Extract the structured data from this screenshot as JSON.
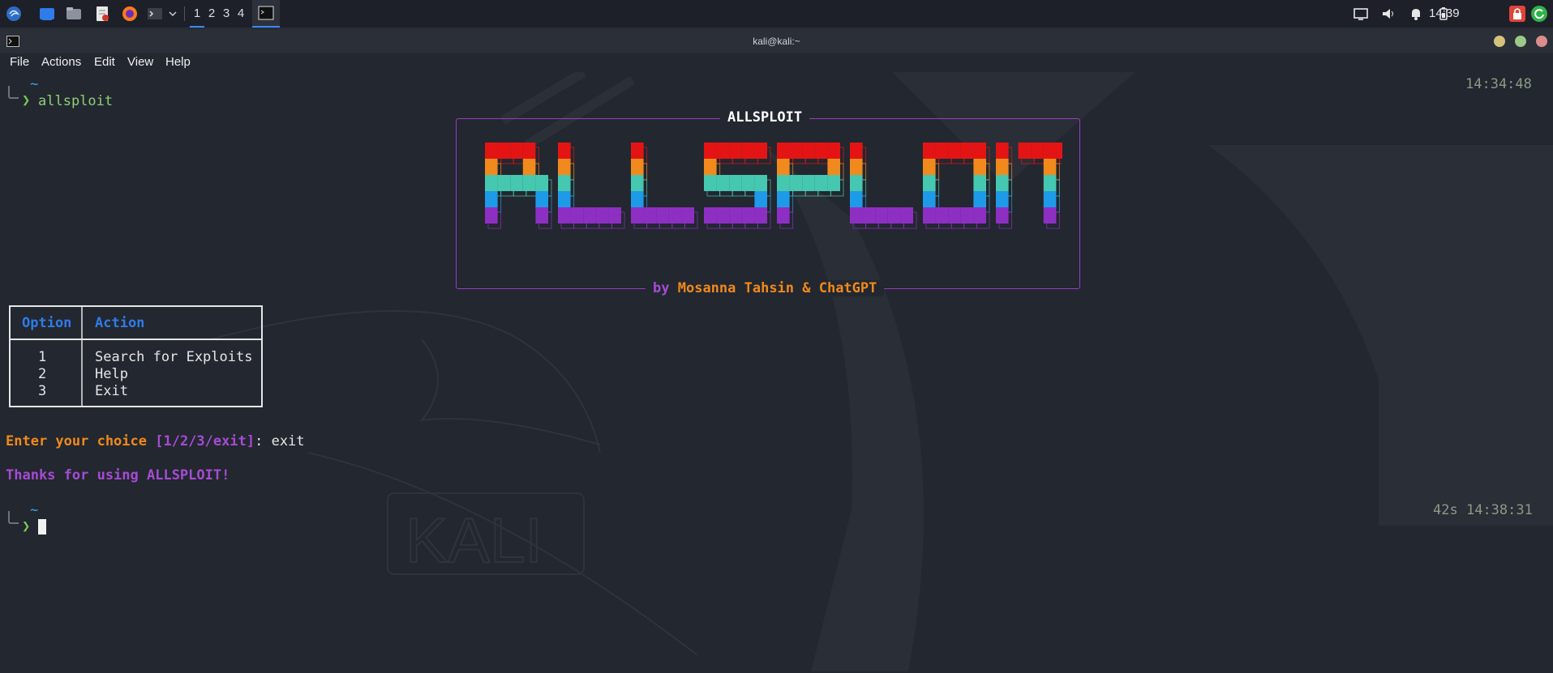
{
  "taskbar": {
    "workspaces": [
      "1",
      "2",
      "3",
      "4"
    ],
    "active_workspace": "1",
    "clock": "14:39",
    "launchers": [
      "kali-menu-icon",
      "files-icon",
      "file-manager-icon",
      "text-editor-icon",
      "firefox-icon",
      "terminal-icon"
    ]
  },
  "window": {
    "title": "kali@kali:~",
    "menu": [
      "File",
      "Actions",
      "Edit",
      "View",
      "Help"
    ]
  },
  "terminal": {
    "prompt1": {
      "dir": "~",
      "command": "allsploit",
      "time": "14:34:48"
    },
    "banner": {
      "title": "ALLSPLOIT",
      "by": "by",
      "authors": "Mosanna Tahsin & ChatGPT",
      "art_text": "ALLSPLOIT",
      "art_colors": [
        "#e51414",
        "#f08a1c",
        "#46c7b0",
        "#1e9be8",
        "#8e2fc4"
      ],
      "border_color": "#9a3cc7"
    },
    "table": {
      "headers": [
        "Option",
        "Action"
      ],
      "rows": [
        {
          "option": "1",
          "action": "Search for Exploits"
        },
        {
          "option": "2",
          "action": "Help"
        },
        {
          "option": "3",
          "action": "Exit"
        }
      ]
    },
    "choice_prompt": {
      "label": "Enter your choice",
      "choices": "[1/2/3/exit]",
      "sep": ":",
      "input": "exit"
    },
    "farewell": "Thanks for using ALLSPLOIT!",
    "prompt2": {
      "dir": "~",
      "duration": "42s",
      "time": "14:38:31"
    }
  }
}
